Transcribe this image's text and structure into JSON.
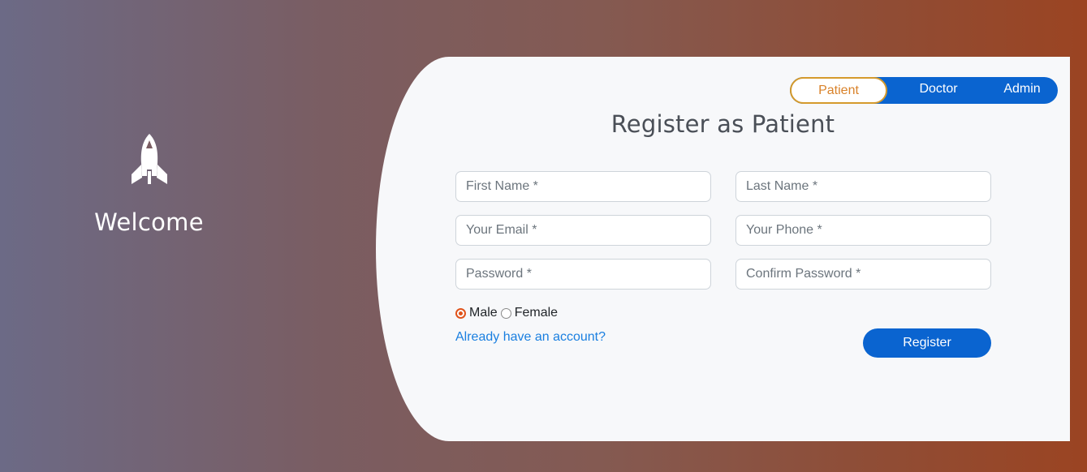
{
  "left_panel": {
    "icon": "rocket-icon",
    "welcome_text": "Welcome"
  },
  "role_tabs": [
    {
      "label": "Patient",
      "active": true
    },
    {
      "label": "Doctor",
      "active": false
    },
    {
      "label": "Admin",
      "active": false
    }
  ],
  "form": {
    "title": "Register as Patient",
    "fields": {
      "first_name": {
        "placeholder": "First Name *",
        "value": ""
      },
      "last_name": {
        "placeholder": "Last Name *",
        "value": ""
      },
      "email": {
        "placeholder": "Your Email *",
        "value": ""
      },
      "phone": {
        "placeholder": "Your Phone *",
        "value": ""
      },
      "password": {
        "placeholder": "Password *",
        "value": ""
      },
      "confirm_password": {
        "placeholder": "Confirm Password *",
        "value": ""
      }
    },
    "gender": {
      "options": [
        "Male",
        "Female"
      ],
      "selected": "Male"
    },
    "login_link": "Already have an account?",
    "submit_label": "Register"
  },
  "colors": {
    "primary_blue": "#0a64d0",
    "active_tab_text": "#d9822a",
    "radio_accent": "#e0531b",
    "link": "#1a7fe0"
  }
}
